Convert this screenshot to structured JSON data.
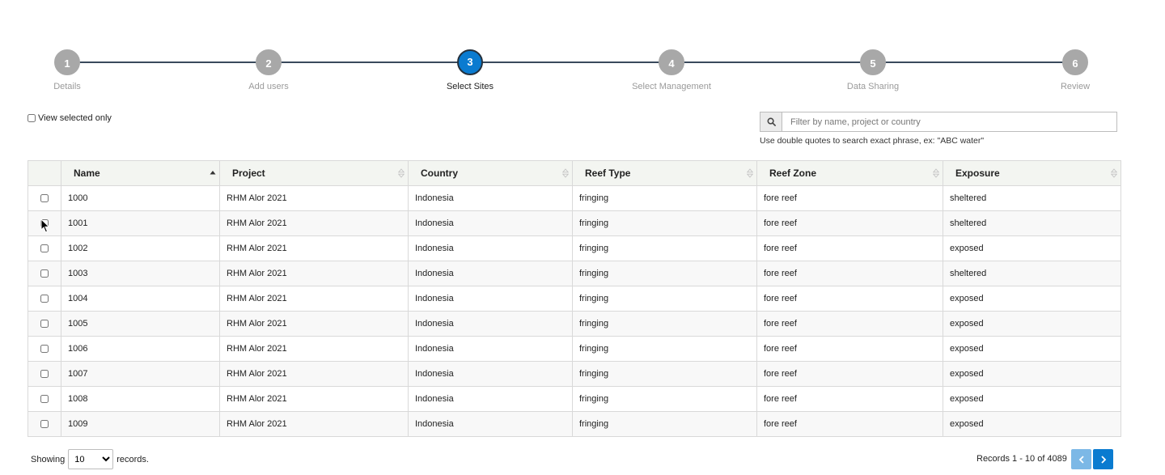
{
  "stepper": {
    "steps": [
      {
        "number": "1",
        "label": "Details"
      },
      {
        "number": "2",
        "label": "Add users"
      },
      {
        "number": "3",
        "label": "Select Sites"
      },
      {
        "number": "4",
        "label": "Select Management"
      },
      {
        "number": "5",
        "label": "Data Sharing"
      },
      {
        "number": "6",
        "label": "Review"
      }
    ],
    "active_step": "3"
  },
  "filters": {
    "view_selected_label": "View selected only",
    "view_selected_checked": false,
    "search_placeholder": "Filter by name, project or country",
    "search_value": "",
    "search_hint": "Use double quotes to search exact phrase, ex: \"ABC water\""
  },
  "table": {
    "columns": [
      {
        "label": "Name",
        "sort": "ascending"
      },
      {
        "label": "Project",
        "sort": "none"
      },
      {
        "label": "Country",
        "sort": "none"
      },
      {
        "label": "Reef Type",
        "sort": "none"
      },
      {
        "label": "Reef Zone",
        "sort": "none"
      },
      {
        "label": "Exposure",
        "sort": "none"
      }
    ],
    "rows": [
      {
        "name": "1000",
        "project": "RHM Alor 2021",
        "country": "Indonesia",
        "reef_type": "fringing",
        "reef_zone": "fore reef",
        "exposure": "sheltered"
      },
      {
        "name": "1001",
        "project": "RHM Alor 2021",
        "country": "Indonesia",
        "reef_type": "fringing",
        "reef_zone": "fore reef",
        "exposure": "sheltered"
      },
      {
        "name": "1002",
        "project": "RHM Alor 2021",
        "country": "Indonesia",
        "reef_type": "fringing",
        "reef_zone": "fore reef",
        "exposure": "exposed"
      },
      {
        "name": "1003",
        "project": "RHM Alor 2021",
        "country": "Indonesia",
        "reef_type": "fringing",
        "reef_zone": "fore reef",
        "exposure": "sheltered"
      },
      {
        "name": "1004",
        "project": "RHM Alor 2021",
        "country": "Indonesia",
        "reef_type": "fringing",
        "reef_zone": "fore reef",
        "exposure": "exposed"
      },
      {
        "name": "1005",
        "project": "RHM Alor 2021",
        "country": "Indonesia",
        "reef_type": "fringing",
        "reef_zone": "fore reef",
        "exposure": "exposed"
      },
      {
        "name": "1006",
        "project": "RHM Alor 2021",
        "country": "Indonesia",
        "reef_type": "fringing",
        "reef_zone": "fore reef",
        "exposure": "exposed"
      },
      {
        "name": "1007",
        "project": "RHM Alor 2021",
        "country": "Indonesia",
        "reef_type": "fringing",
        "reef_zone": "fore reef",
        "exposure": "exposed"
      },
      {
        "name": "1008",
        "project": "RHM Alor 2021",
        "country": "Indonesia",
        "reef_type": "fringing",
        "reef_zone": "fore reef",
        "exposure": "exposed"
      },
      {
        "name": "1009",
        "project": "RHM Alor 2021",
        "country": "Indonesia",
        "reef_type": "fringing",
        "reef_zone": "fore reef",
        "exposure": "exposed"
      }
    ]
  },
  "footer": {
    "showing_label": "Showing",
    "records_label": "records.",
    "page_size": "10",
    "page_size_options": [
      "10"
    ],
    "records_info": "Records 1 - 10 of 4089"
  },
  "colors": {
    "accent": "#0a7bd0",
    "step_inactive": "#a8a8a8",
    "pager_disabled": "#7cb8e6",
    "header_bg": "#f3f5f1"
  },
  "icons": {
    "search": "search-icon",
    "prev": "chevron-left-icon",
    "next": "chevron-right-icon",
    "sort": "sort-icon",
    "cursor": "cursor-arrow-icon"
  }
}
